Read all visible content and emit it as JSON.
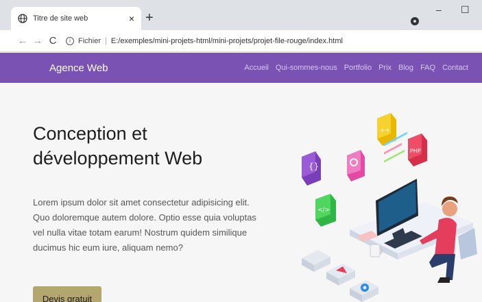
{
  "browser": {
    "tab_title": "Titre de site web",
    "tab_close": "×",
    "new_tab": "+",
    "minimize": "–",
    "maximize": "☐",
    "back": "←",
    "forward": "→",
    "reload": "C",
    "info": "i",
    "url_prefix": "Fichier",
    "url": "E:/exemples/mini-projets-html/mini-projets/projet-file-rouge/index.html"
  },
  "site": {
    "brand": "Agence Web",
    "nav": [
      "Accueil",
      "Qui-sommes-nous",
      "Portfolio",
      "Prix",
      "Blog",
      "FAQ",
      "Contact"
    ]
  },
  "hero": {
    "title": "Conception et développement Web",
    "body": "Lorem ipsum dolor sit amet consectetur adipisicing elit. Quo doloremque autem dolore. Optio esse quia voluptas vel nulla vitae totam earum! Nostrum quidem similique ducimus hic eum iure, aliquam nemo?",
    "cta": "Devis gratuit"
  },
  "colors": {
    "header": "#7952b3",
    "cta": "#b3a66e"
  }
}
